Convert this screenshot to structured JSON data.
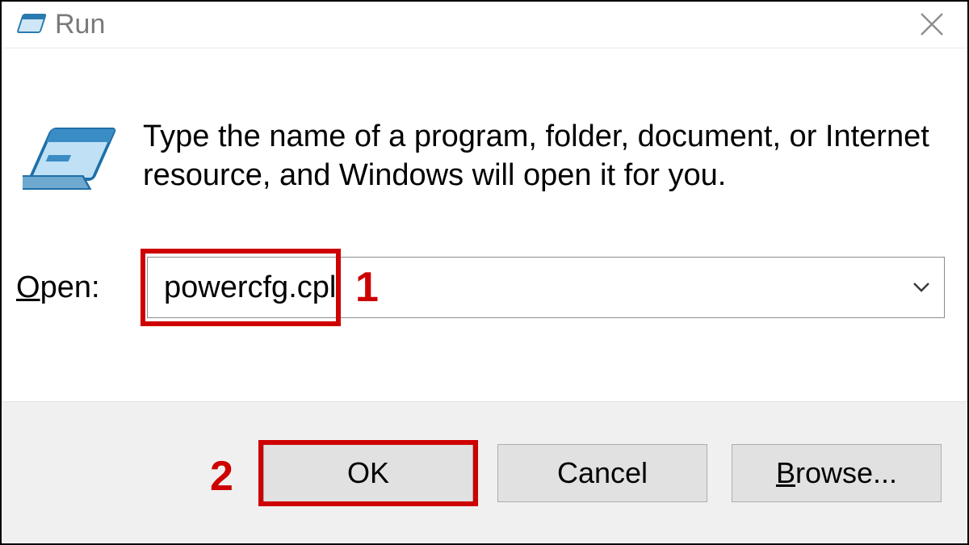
{
  "window": {
    "title": "Run",
    "close_tooltip": "Close"
  },
  "instruction_text": "Type the name of a program, folder, document, or Internet resource, and Windows will open it for you.",
  "open": {
    "label_pre": "O",
    "label_post": "pen:",
    "value": "powercfg.cpl"
  },
  "buttons": {
    "ok": "OK",
    "cancel": "Cancel",
    "browse_pre": "B",
    "browse_post": "rowse..."
  },
  "annotations": {
    "n1": "1",
    "n2": "2"
  }
}
